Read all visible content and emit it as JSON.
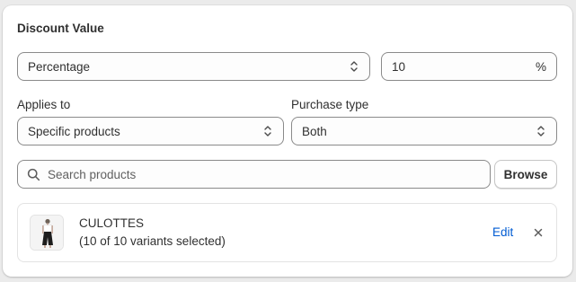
{
  "discount": {
    "section_title": "Discount Value",
    "type_select": {
      "value": "Percentage"
    },
    "amount_input": {
      "value": "10",
      "suffix": "%"
    }
  },
  "applies_to": {
    "label": "Applies to",
    "value": "Specific products"
  },
  "purchase_type": {
    "label": "Purchase type",
    "value": "Both"
  },
  "search": {
    "placeholder": "Search products",
    "browse_label": "Browse"
  },
  "selected_products": [
    {
      "name": "CULOTTES",
      "variants": "(10 of 10 variants selected)",
      "edit_label": "Edit"
    }
  ],
  "icons": {
    "select": "chevron-up-down-icon",
    "search": "search-icon",
    "remove": "close-icon"
  },
  "colors": {
    "link": "#005bd3",
    "text": "#303030",
    "border": "#8a8a8a"
  }
}
